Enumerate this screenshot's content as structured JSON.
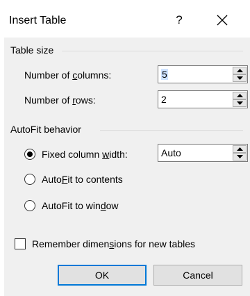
{
  "dialog": {
    "title": "Insert Table",
    "help_label": "?",
    "close_icon": "close-icon"
  },
  "table_size": {
    "group_label": "Table size",
    "columns": {
      "label_pre": "Number of ",
      "label_key": "c",
      "label_post": "olumns:",
      "value": "5"
    },
    "rows": {
      "label_pre": "Number of ",
      "label_key": "r",
      "label_post": "ows:",
      "value": "2"
    }
  },
  "autofit": {
    "group_label": "AutoFit behavior",
    "fixed": {
      "label_pre": "Fixed column ",
      "label_key": "w",
      "label_post": "idth:",
      "value": "Auto",
      "selected": true
    },
    "contents": {
      "label_pre": "Auto",
      "label_key": "F",
      "label_post": "it to contents",
      "selected": false
    },
    "window": {
      "label_pre": "AutoFit to win",
      "label_key": "d",
      "label_post": "ow",
      "selected": false
    }
  },
  "remember": {
    "label_pre": "Remember dimen",
    "label_key": "s",
    "label_post": "ions for new tables",
    "checked": false
  },
  "buttons": {
    "ok": "OK",
    "cancel": "Cancel"
  },
  "colors": {
    "accent": "#0078d7",
    "dialog_bg": "#f0f0f0",
    "selection": "#cfe3ff"
  }
}
